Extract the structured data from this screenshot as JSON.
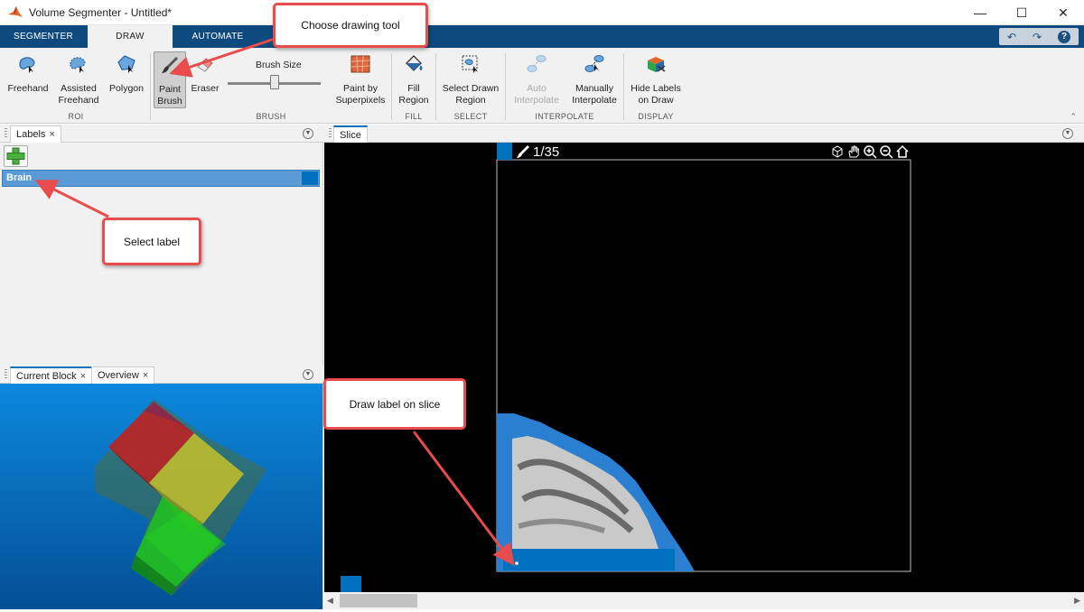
{
  "window": {
    "title": "Volume Segmenter - Untitled*",
    "minimize": "—",
    "maximize": "☐",
    "close": "✕"
  },
  "tabs": [
    {
      "label": "SEGMENTER"
    },
    {
      "label": "DRAW"
    },
    {
      "label": "AUTOMATE"
    }
  ],
  "quick_access": {
    "undo": "↶",
    "redo": "↷",
    "help": "?"
  },
  "ribbon": {
    "roi": {
      "section": "ROI",
      "freehand": "Freehand",
      "assisted_1": "Assisted",
      "assisted_2": "Freehand",
      "polygon": "Polygon"
    },
    "brush": {
      "section": "BRUSH",
      "paint_1": "Paint",
      "paint_2": "Brush",
      "eraser": "Eraser",
      "brush_size": "Brush Size",
      "brush_size_level": 0.5,
      "superpixels_1": "Paint by",
      "superpixels_2": "Superpixels"
    },
    "fill": {
      "section": "FILL",
      "line1": "Fill",
      "line2": "Region"
    },
    "select": {
      "section": "SELECT",
      "line1": "Select Drawn",
      "line2": "Region"
    },
    "interpolate": {
      "section": "INTERPOLATE",
      "auto_1": "Auto",
      "auto_2": "Interpolate",
      "manual_1": "Manually",
      "manual_2": "Interpolate"
    },
    "display": {
      "section": "DISPLAY",
      "line1": "Hide Labels",
      "line2": "on Draw"
    }
  },
  "labels_panel": {
    "tab": "Labels",
    "tab_close": "×",
    "add": "+",
    "items": [
      {
        "name": "Brain",
        "color": "#0072bd"
      }
    ]
  },
  "block_panel": {
    "tab1": "Current Block",
    "tab1_close": "×",
    "tab2": "Overview",
    "tab2_close": "×"
  },
  "slice_panel": {
    "tab": "Slice",
    "slice_counter": "1/35"
  },
  "colors": {
    "accent": "#0072bd",
    "tabstrip": "#0e4a7d",
    "callout_border": "#e84c4c"
  },
  "callouts": {
    "tool": "Choose drawing tool",
    "label": "Select label",
    "draw": "Draw label on slice"
  }
}
